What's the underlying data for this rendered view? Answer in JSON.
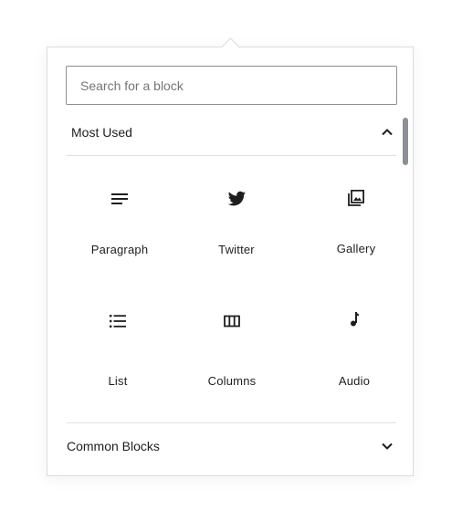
{
  "search": {
    "placeholder": "Search for a block",
    "value": ""
  },
  "panels": {
    "most_used": {
      "title": "Most Used",
      "expanded_icon": "chevron-up-icon",
      "items": [
        {
          "label": "Paragraph",
          "icon": "paragraph-icon"
        },
        {
          "label": "Twitter",
          "icon": "twitter-icon"
        },
        {
          "label": "Gallery",
          "icon": "gallery-icon"
        },
        {
          "label": "List",
          "icon": "list-icon"
        },
        {
          "label": "Columns",
          "icon": "columns-icon"
        },
        {
          "label": "Audio",
          "icon": "audio-icon"
        }
      ]
    },
    "common": {
      "title": "Common Blocks",
      "collapsed_icon": "chevron-down-icon"
    }
  },
  "colors": {
    "text": "#1e1e1e",
    "border": "#8c8f94",
    "divider": "#e0e0e0",
    "placeholder": "#757575"
  }
}
